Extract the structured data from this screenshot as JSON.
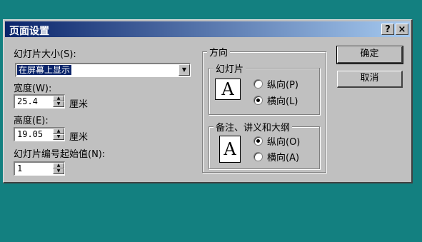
{
  "window": {
    "title": "页面设置",
    "help_label": "?",
    "close_label": "×"
  },
  "slide_size": {
    "label": "幻灯片大小(S):",
    "selected": "在屏幕上显示"
  },
  "width": {
    "label": "宽度(W):",
    "value": "25.4",
    "unit": "厘米"
  },
  "height": {
    "label": "高度(E):",
    "value": "19.05",
    "unit": "厘米"
  },
  "numbering": {
    "label": "幻灯片编号起始值(N):",
    "value": "1"
  },
  "orientation": {
    "group_title": "方向",
    "slides": {
      "title": "幻灯片",
      "portrait_label": "纵向(P)",
      "landscape_label": "横向(L)",
      "selected": "landscape"
    },
    "notes": {
      "title": "备注、讲义和大纲",
      "portrait_label": "纵向(O)",
      "landscape_label": "横向(A)",
      "selected": "portrait"
    },
    "page_glyph": "A"
  },
  "buttons": {
    "ok": "确定",
    "cancel": "取消"
  },
  "colors": {
    "desktop": "#138080",
    "dialog": "#c0c0c0",
    "title_start": "#0a246a",
    "title_end": "#a6caf0"
  }
}
